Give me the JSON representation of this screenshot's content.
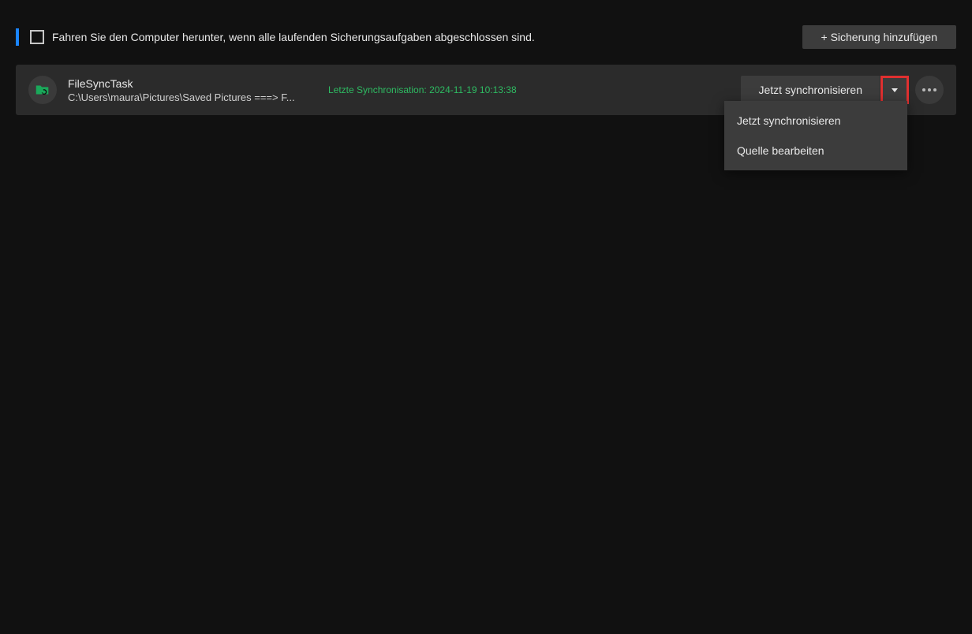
{
  "header": {
    "shutdown_label": "Fahren Sie den Computer herunter, wenn alle laufenden Sicherungsaufgaben abgeschlossen sind.",
    "add_backup_label": "+ Sicherung hinzufügen"
  },
  "task": {
    "name": "FileSyncTask",
    "path": "C:\\Users\\maura\\Pictures\\Saved Pictures ===> F...",
    "status": "Letzte Synchronisation: 2024-11-19 10:13:38",
    "sync_label": "Jetzt synchronisieren"
  },
  "dropdown": {
    "items": [
      {
        "label": "Jetzt synchronisieren"
      },
      {
        "label": "Quelle bearbeiten"
      }
    ]
  }
}
